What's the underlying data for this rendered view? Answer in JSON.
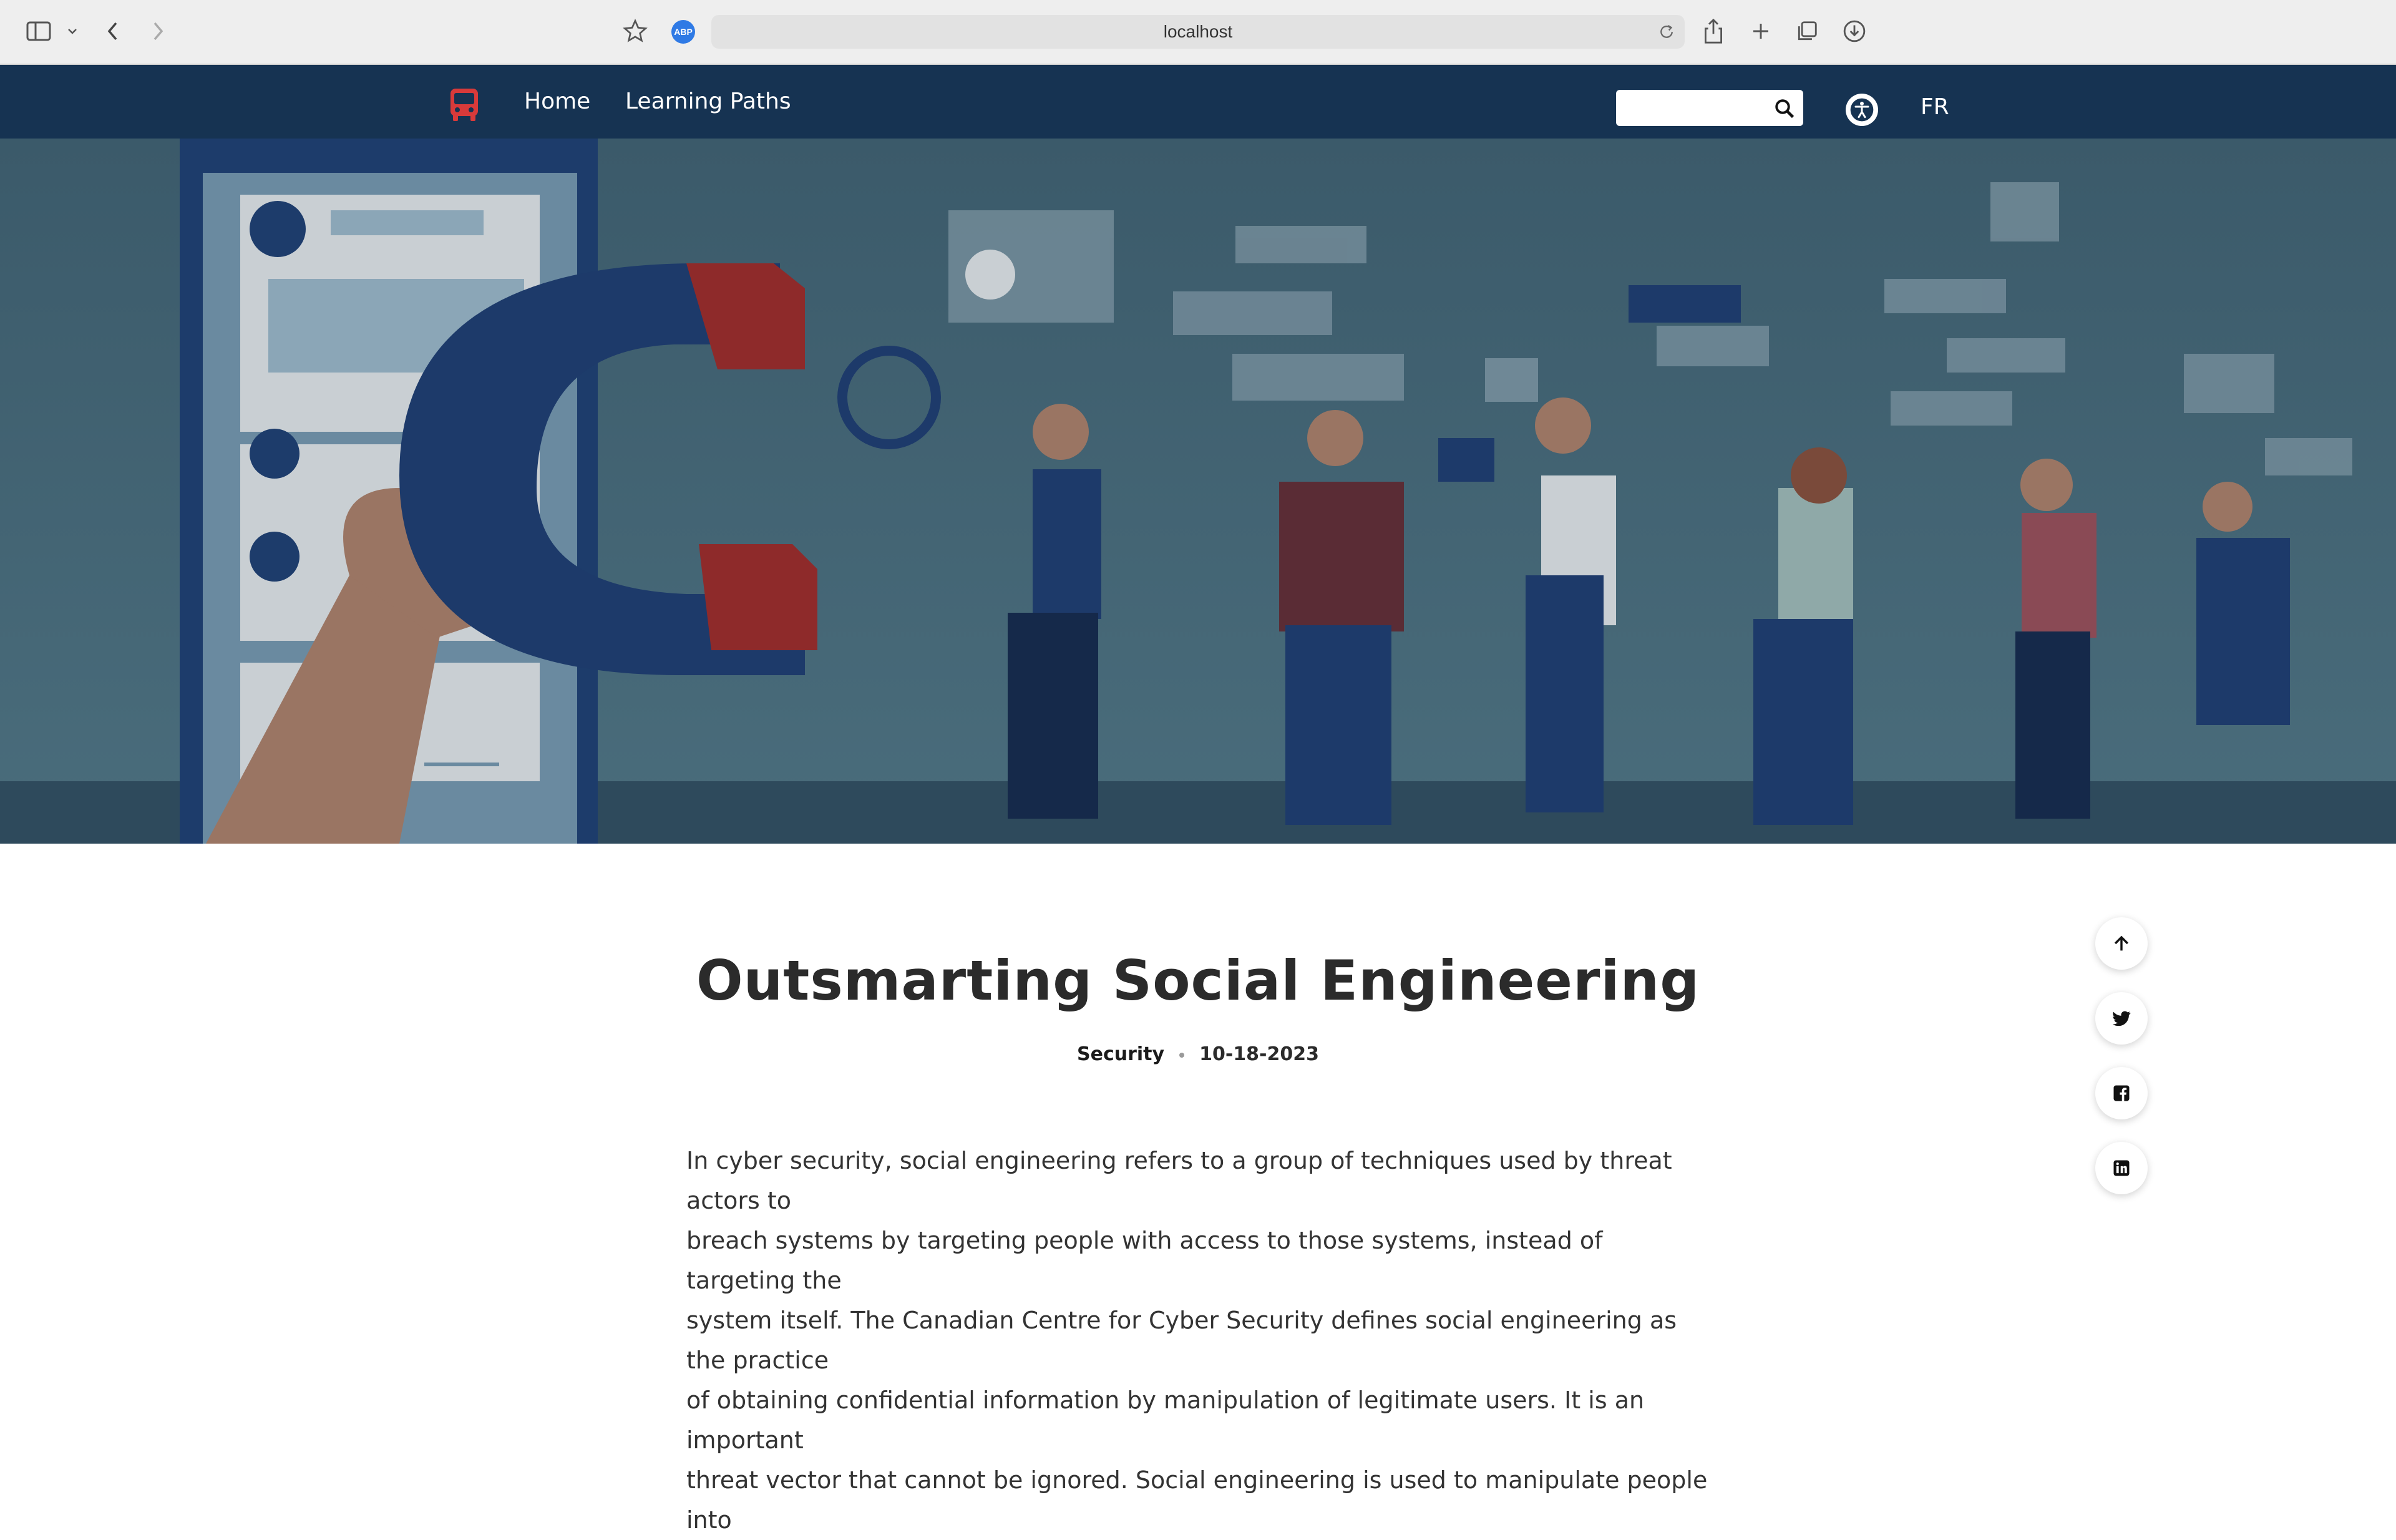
{
  "browser": {
    "url": "localhost",
    "extension_badge": "ABP",
    "icons": [
      "sidebar-icon",
      "chevron-down-icon",
      "back-icon",
      "forward-icon",
      "star-icon",
      "reload-icon",
      "share-icon",
      "new-tab-icon",
      "tabs-icon",
      "download-icon"
    ]
  },
  "nav": {
    "logo_icon": "bus-icon",
    "links": [
      "Home",
      "Learning Paths"
    ],
    "search_placeholder": "",
    "search_icon": "search-icon",
    "accessibility_icon": "accessibility-icon",
    "language": "FR"
  },
  "article": {
    "title": "Outsmarting Social Engineering",
    "category": "Security",
    "date": "10-18-2023",
    "lines": [
      "In cyber security, social engineering refers to a group of techniques used by threat actors to",
      "breach systems by targeting people with access to those systems, instead of targeting the",
      "system itself. The Canadian Centre for Cyber Security defines social engineering as the practice",
      "of obtaining confidential information by manipulation of legitimate users. It is an important",
      "threat vector that cannot be ignored. Social engineering is used to manipulate people into"
    ]
  },
  "share": {
    "icons": [
      "arrow-up-icon",
      "twitter-icon",
      "facebook-icon",
      "linkedin-icon"
    ]
  },
  "colors": {
    "nav_bg": "#163352",
    "hero_bg": "#3f5f6f",
    "accent_red": "#c0392b",
    "text": "#333333"
  }
}
